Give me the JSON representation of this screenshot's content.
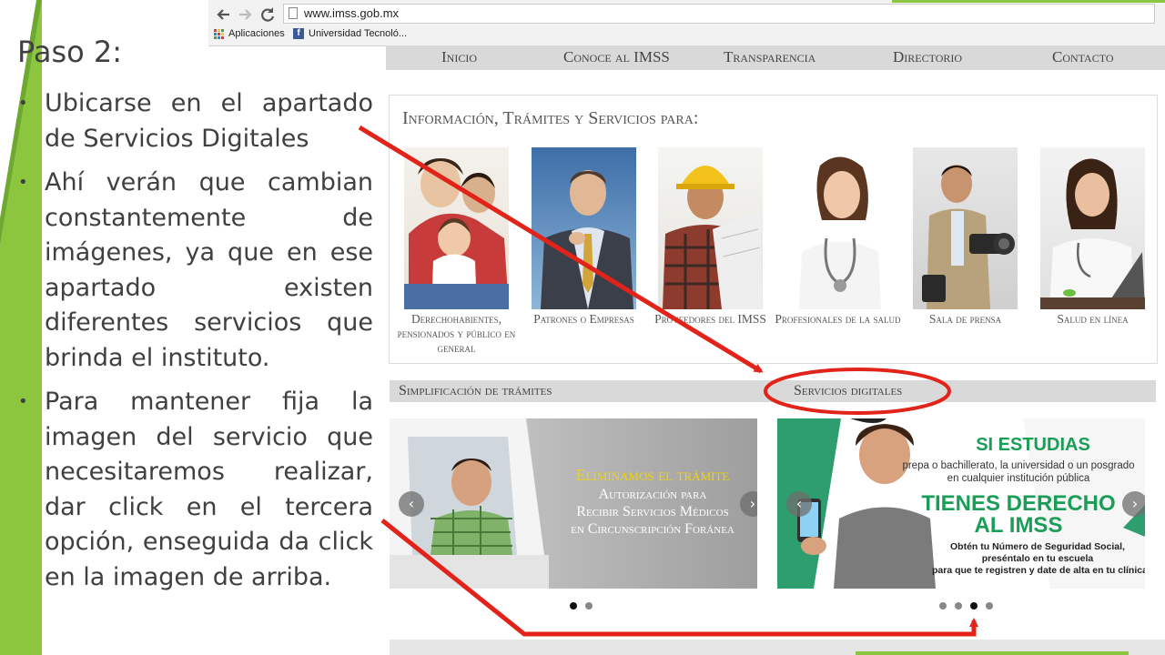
{
  "slide": {
    "title": "Paso 2:",
    "bullet_glyph": "•",
    "bullets": [
      "Ubicarse en el apartado de Servicios Digitales",
      "Ahí verán que cambian constantemente de imágenes, ya que en ese apartado existen diferentes servicios que brinda el instituto.",
      "Para mantener fija la imagen del servicio que necesitaremos realizar, dar click en el tercera opción, enseguida da click en la imagen de arriba."
    ]
  },
  "browser": {
    "back_icon": "arrow-left-icon",
    "forward_icon": "arrow-right-icon",
    "reload_icon": "reload-icon",
    "url": "www.imss.gob.mx",
    "bookmarks": [
      "Aplicaciones",
      "Universidad Tecnoló..."
    ]
  },
  "site": {
    "nav": [
      "Inicio",
      "Conoce al IMSS",
      "Transparencia",
      "Directorio",
      "Contacto"
    ],
    "info_title": "Información, Trámites y Servicios para:",
    "cards": [
      {
        "label": "Derechohabientes, pensionados y público en general"
      },
      {
        "label": "Patrones o Empresas"
      },
      {
        "label": "Proveedores del IMSS"
      },
      {
        "label": "Profesionales de la salud"
      },
      {
        "label": "Sala de prensa"
      },
      {
        "label": "Salud en línea"
      }
    ],
    "section_left": "Simplificación de trámites",
    "section_right": "Servicios digitales",
    "banner_left": {
      "line1": "Eliminamos el trámite",
      "line2": "Autorización para",
      "line3": "Recibir Servicios Médicos",
      "line4": "en Circunscripción Foránea",
      "dots_total": 2,
      "dots_active": 1
    },
    "banner_right": {
      "headline": "SI ESTUDIAS",
      "sub1": "prepa o bachillerato, la universidad o un posgrado",
      "sub2": "en cualquier institución pública",
      "big1": "TIENES DERECHO",
      "big2": "AL IMSS",
      "foot1": "Obtén tu Número de Seguridad Social,",
      "foot2": "preséntalo en tu escuela",
      "foot3": "para que te registren y date de alta en tu clínica.",
      "dots_total": 4,
      "dots_active": 3
    },
    "prev_glyph": "‹",
    "next_glyph": "›"
  },
  "colors": {
    "slide_green": "#8cc63f",
    "title_text": "#404040",
    "nav_gray": "#d9d9d9",
    "annotation_red": "#e2231a",
    "banner_green": "#2e9e6e",
    "banner_headline_green": "#1a9e57"
  }
}
